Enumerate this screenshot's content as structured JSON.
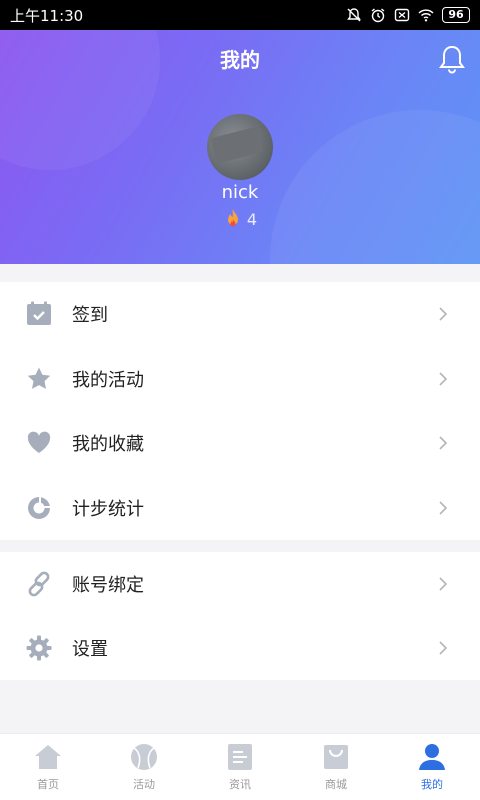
{
  "status_bar": {
    "time": "上午11:30",
    "battery": "96"
  },
  "header": {
    "title": "我的"
  },
  "profile": {
    "username": "nick",
    "fire_count": "4"
  },
  "menu_group_1": [
    {
      "label": "签到",
      "icon": "calendar-check-icon"
    },
    {
      "label": "我的活动",
      "icon": "star-icon"
    },
    {
      "label": "我的收藏",
      "icon": "heart-icon"
    },
    {
      "label": "计步统计",
      "icon": "ring-chart-icon"
    }
  ],
  "menu_group_2": [
    {
      "label": "账号绑定",
      "icon": "link-icon"
    },
    {
      "label": "设置",
      "icon": "gear-icon"
    }
  ],
  "tabbar": {
    "tabs": [
      {
        "label": "首页",
        "icon": "home-icon",
        "active": false
      },
      {
        "label": "活动",
        "icon": "ball-icon",
        "active": false
      },
      {
        "label": "资讯",
        "icon": "news-icon",
        "active": false
      },
      {
        "label": "商城",
        "icon": "bag-icon",
        "active": false
      },
      {
        "label": "我的",
        "icon": "person-icon",
        "active": true
      }
    ]
  },
  "colors": {
    "accent": "#2c6fe0",
    "icon_gray": "#a6adbb",
    "tab_gray": "#c8ccd4"
  }
}
